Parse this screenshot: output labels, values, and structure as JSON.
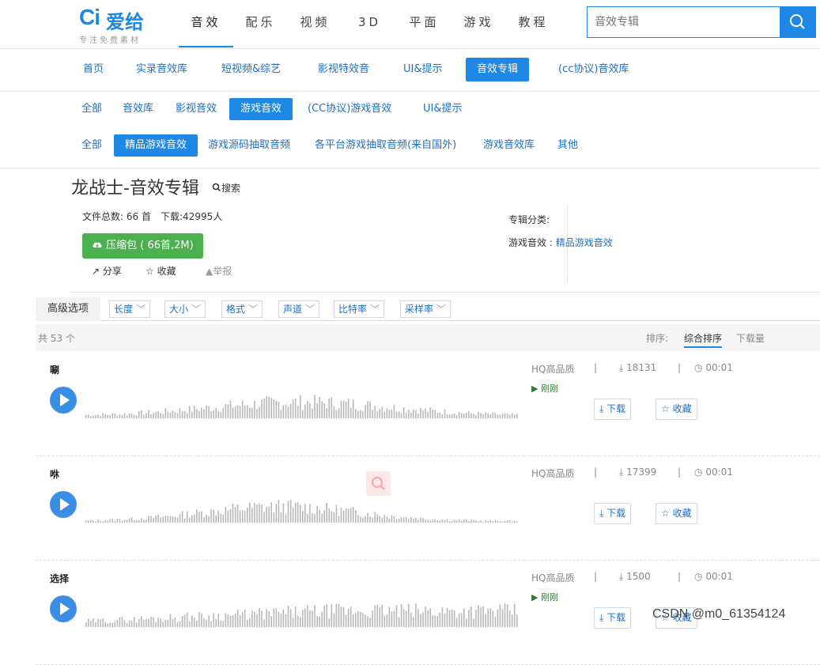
{
  "logo": {
    "mark": "Ci",
    "name": "爱给",
    "slogan": "专注免费素材"
  },
  "main_nav": [
    "音效",
    "配乐",
    "视频",
    "3D",
    "平面",
    "游戏",
    "教程"
  ],
  "search": {
    "placeholder": "音效专辑"
  },
  "subnav1": [
    "首页",
    "实录音效库",
    "短视频&综艺",
    "影视特效音",
    "UI&提示",
    "音效专辑",
    "(cc协议)音效库"
  ],
  "subnav2_row1": [
    "全部",
    "音效库",
    "影视音效",
    "游戏音效",
    "(CC协议)游戏音效",
    "UI&提示"
  ],
  "subnav2_row2": [
    "全部",
    "精品游戏音效",
    "游戏源码抽取音频",
    "各平台游戏抽取音频(来自国外)",
    "游戏音效库",
    "其他"
  ],
  "album": {
    "title": "龙战士-音效专辑",
    "search_label": "搜索",
    "file_count": "文件总数: 66 首",
    "downloads": "下载:42995人",
    "zip_label": "压缩包 ( 66首,2M)",
    "share": "分享",
    "favorite": "收藏",
    "report": "举报",
    "category_label": "专辑分类:",
    "category_prefix": "游戏音效 : ",
    "category_link": "精品游戏音效"
  },
  "filters": {
    "label": "高级选项",
    "items": [
      "长度",
      "大小",
      "格式",
      "声道",
      "比特率",
      "采样率"
    ]
  },
  "list": {
    "total": "共 53 个",
    "sort_label": "排序:",
    "sort_options": [
      "综合排序",
      "下载量"
    ],
    "active_sort": "综合排序"
  },
  "sounds": [
    {
      "name": "唰",
      "quality": "HQ高品质",
      "downloads": "18131",
      "duration": "00:01",
      "tag": "刚刚",
      "download_label": "下载",
      "fav_label": "收藏"
    },
    {
      "name": "咻",
      "quality": "HQ高品质",
      "downloads": "17399",
      "duration": "00:01",
      "tag": "",
      "download_label": "下载",
      "fav_label": "收藏"
    },
    {
      "name": "选择",
      "quality": "HQ高品质",
      "downloads": "1500",
      "duration": "00:01",
      "tag": "刚刚",
      "download_label": "下载",
      "fav_label": "收藏"
    }
  ],
  "watermark": "CSDN @m0_61354124",
  "colors": {
    "accent": "#1e88e5",
    "green": "#4caf50",
    "link": "#1e6fc6"
  }
}
